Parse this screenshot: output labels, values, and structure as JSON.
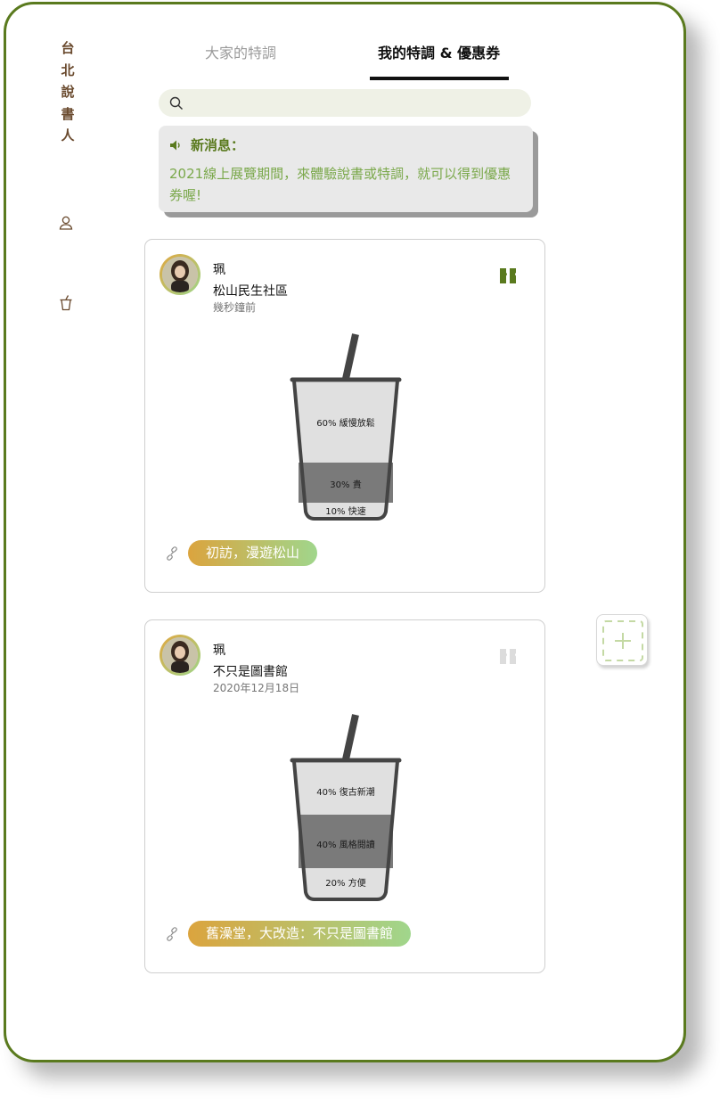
{
  "app": {
    "brand": "台北說書人",
    "brand_chars": [
      "台",
      "北",
      "說",
      "書",
      "人"
    ]
  },
  "tabs": [
    {
      "label": "大家的特調",
      "active": false
    },
    {
      "label": "我的特調 & 優惠券",
      "active": true
    }
  ],
  "search": {
    "placeholder": "",
    "value": ""
  },
  "notice": {
    "title": "新消息：",
    "body": "2021線上展覽期間，來體驗說書或特調，就可以得到優惠券喔!"
  },
  "posts": [
    {
      "author": "珮",
      "place": "松山民生社區",
      "time": "幾秒鐘前",
      "coupon_active": true,
      "cup_layers": [
        {
          "percent": 60,
          "label": "60% 緩慢放鬆"
        },
        {
          "percent": 30,
          "label": "30% 貴"
        },
        {
          "percent": 10,
          "label": "10% 快速"
        }
      ],
      "tag": "初訪，漫遊松山"
    },
    {
      "author": "珮",
      "place": "不只是圖書館",
      "time": "2020年12月18日",
      "coupon_active": false,
      "cup_layers": [
        {
          "percent": 40,
          "label": "40% 復古新潮"
        },
        {
          "percent": 40,
          "label": "40% 風格閱讀"
        },
        {
          "percent": 20,
          "label": "20% 方便"
        }
      ],
      "tag": "舊澡堂，大改造：不只是圖書館"
    }
  ],
  "colors": {
    "brand": "#6a4a2e",
    "accent_green": "#5a7a1e",
    "notice_text": "#7aa84a",
    "coupon_active": "#5a7a1e",
    "coupon_inactive": "#dcdcdc",
    "tag_gradient_start": "#dba43e",
    "tag_gradient_end": "#a0d68c"
  },
  "icons": {
    "search": "search-icon",
    "speaker": "speaker-icon",
    "profile": "user-icon",
    "drink": "cup-icon",
    "coupon": "coupon-icon",
    "link": "link-icon",
    "add": "add-icon"
  }
}
